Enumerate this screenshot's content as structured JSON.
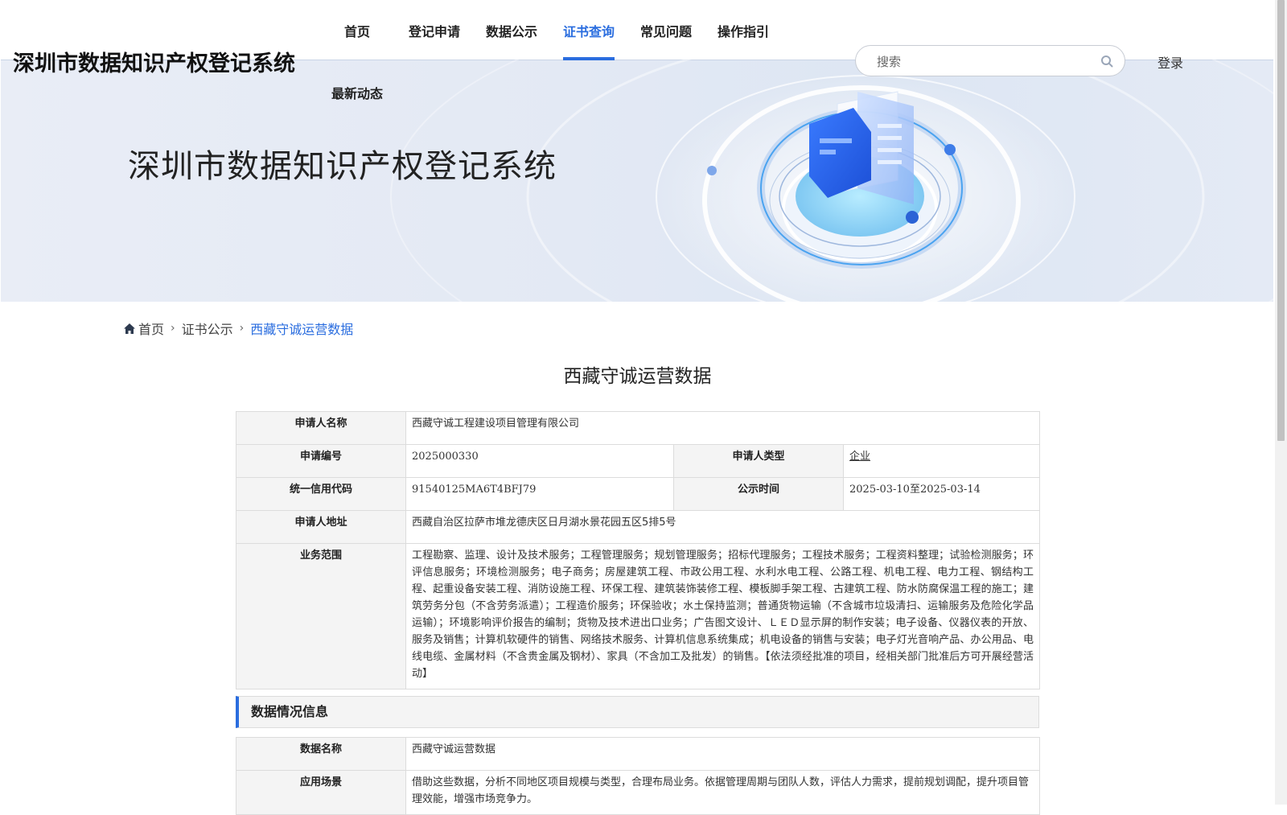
{
  "header": {
    "site_title": "深圳市数据知识产权登记系统",
    "nav": [
      {
        "label": "首页"
      },
      {
        "label": "登记申请"
      },
      {
        "label": "数据公示"
      },
      {
        "label": "证书查询",
        "active": true
      },
      {
        "label": "常见问题"
      },
      {
        "label": "操作指引"
      },
      {
        "label": "最新动态"
      }
    ],
    "search": {
      "placeholder": "搜索",
      "icon": "search-icon"
    },
    "login_label": "登录"
  },
  "banner": {
    "title": "深圳市数据知识产权登记系统"
  },
  "breadcrumb": {
    "home_icon": "home-icon",
    "items": [
      "首页",
      "证书公示",
      "西藏守诚运营数据"
    ]
  },
  "page_title": "西藏守诚运营数据",
  "applicant": {
    "name_label": "申请人名称",
    "name_value": "西藏守诚工程建设项目管理有限公司",
    "number_label": "申请编号",
    "number_value": "2025000330",
    "type_label": "申请人类型",
    "type_value": "企业",
    "credit_label": "统一信用代码",
    "credit_value": "91540125MA6T4BFJ79",
    "publicity_label": "公示时间",
    "publicity_value": "2025-03-10至2025-03-14",
    "address_label": "申请人地址",
    "address_value": "西藏自治区拉萨市堆龙德庆区日月湖水景花园五区5排5号",
    "scope_label": "业务范围",
    "scope_value": "工程勘察、监理、设计及技术服务；工程管理服务；规划管理服务；招标代理服务；工程技术服务；工程资料整理；试验检测服务；环评信息服务；环境检测服务；电子商务；房屋建筑工程、市政公用工程、水利水电工程、公路工程、机电工程、电力工程、钢结构工程、起重设备安装工程、消防设施工程、环保工程、建筑装饰装修工程、模板脚手架工程、古建筑工程、防水防腐保温工程的施工；建筑劳务分包（不含劳务派遣）；工程造价服务；环保验收；水土保持监测；普通货物运输（不含城市垃圾清扫、运输服务及危险化学品运输）；环境影响评价报告的编制；货物及技术进出口业务；广告图文设计、ＬＥＤ显示屏的制作安装；电子设备、仪器仪表的开放、服务及销售；计算机软硬件的销售、网络技术服务、计算机信息系统集成；机电设备的销售与安装；电子灯光音响产品、办公用品、电线电缆、金属材料（不含贵金属及钢材）、家具（不含加工及批发）的销售。【依法须经批准的项目，经相关部门批准后方可开展经营活动】"
  },
  "data_section": {
    "header": "数据情况信息",
    "data_name_label": "数据名称",
    "data_name_value": "西藏守诚运营数据",
    "scenario_label": "应用场景",
    "scenario_value": "借助这些数据，分析不同地区项目规模与类型，合理布局业务。依据管理周期与团队人数，评估人力需求，提前规划调配，提升项目管理效能，增强市场竞争力。"
  },
  "colors": {
    "accent": "#2a6ddf",
    "label_bg": "#f4f4f4",
    "border": "#dcdcdc"
  }
}
